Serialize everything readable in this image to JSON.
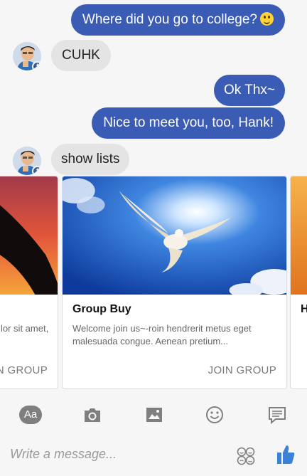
{
  "messages": [
    {
      "from": "me",
      "text": "Where did you go to college?"
    },
    {
      "from": "bot",
      "text": "CUHK"
    },
    {
      "from": "me",
      "text": "Ok Thx~"
    },
    {
      "from": "me",
      "text": "Nice to meet you, too, Hank!"
    },
    {
      "from": "bot",
      "text": "show lists"
    }
  ],
  "cards": [
    {
      "title": "",
      "subtitle": "lor sit amet,",
      "button": "JOIN GROUP"
    },
    {
      "title": "Group Buy",
      "subtitle": "Welcome join us~-roin hendrerit metus eget malesuada congue. Aenean pretium...",
      "button": "JOIN GROUP"
    },
    {
      "title": "H",
      "subtitle": "",
      "button": ""
    }
  ],
  "toolbar": {
    "icons": [
      "text-format-icon",
      "camera-icon",
      "image-icon",
      "emoji-icon",
      "chat-icon"
    ],
    "text_format_label": "Aa"
  },
  "composer": {
    "placeholder": "Write a message...",
    "sticker_icon": "sticker-icon",
    "like_icon": "thumbs-up-icon"
  },
  "colors": {
    "outgoing_bubble": "#3b5cb5",
    "incoming_bubble": "#e4e4e4",
    "like_blue": "#3b82d6"
  }
}
